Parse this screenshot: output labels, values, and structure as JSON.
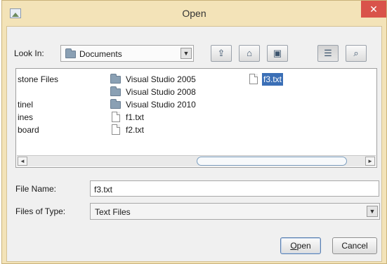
{
  "window": {
    "title": "Open",
    "close_glyph": "✕"
  },
  "look_in": {
    "label": "Look In:",
    "value": "Documents",
    "arrow": "▼"
  },
  "toolbar": [
    {
      "name": "up-one-level-button",
      "icon": "up-folder-icon",
      "glyph": "⇪"
    },
    {
      "name": "home-button",
      "icon": "home-icon",
      "glyph": "⌂"
    },
    {
      "name": "new-folder-button",
      "icon": "new-folder-icon",
      "glyph": "▣"
    },
    {
      "name": "list-view-button",
      "icon": "list-view-icon",
      "glyph": "☰"
    },
    {
      "name": "details-view-button",
      "icon": "details-view-icon",
      "glyph": "⌕"
    }
  ],
  "file_list": {
    "column1": [
      "stone Files",
      "tinel",
      "ines",
      "board"
    ],
    "column2": [
      {
        "name": "Visual Studio 2005",
        "type": "folder"
      },
      {
        "name": "Visual Studio 2008",
        "type": "folder"
      },
      {
        "name": "Visual Studio 2010",
        "type": "folder"
      },
      {
        "name": "f1.txt",
        "type": "file"
      },
      {
        "name": "f2.txt",
        "type": "file"
      }
    ],
    "column3": [
      {
        "name": "f3.txt",
        "type": "file",
        "selected": true
      }
    ],
    "scroll_left": "◄",
    "scroll_right": "►"
  },
  "file_name": {
    "label": "File Name:",
    "value": "f3.txt"
  },
  "files_of_type": {
    "label": "Files of Type:",
    "value": "Text Files",
    "arrow": "▼"
  },
  "buttons": {
    "open_mnemonic": "O",
    "open_rest": "pen",
    "cancel": "Cancel"
  },
  "colors": {
    "title_bar": "#f3e3b8",
    "selection": "#3b6fb6",
    "close_button": "#d9534a"
  }
}
